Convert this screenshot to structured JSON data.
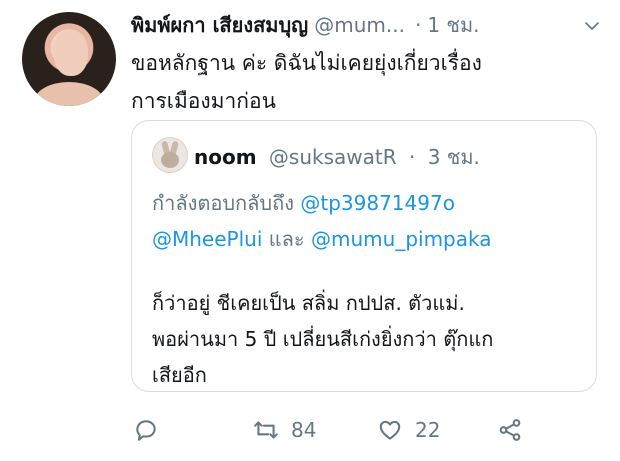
{
  "tweet": {
    "display_name": "พิมพ์ผกา เสียงสมบุญ",
    "handle": "@mum...",
    "dot": "·",
    "time": "1 ชม.",
    "text": "ขอหลักฐาน ค่ะ ดิฉันไม่เคยยุ่งเกี่ยวเรื่อง\nการเมืองมาก่อน"
  },
  "quoted": {
    "name": "noom",
    "handle": "@suksawatR",
    "dot": "·",
    "time": "3 ชม.",
    "reply_prefix": "กำลังตอบกลับถึง ",
    "reply_mention_1": "@tp39871497o",
    "reply_mention_2": "@MheePlui",
    "reply_and": " และ ",
    "reply_mention_3": "@mumu_pimpaka",
    "text": "ก็ว่าอยู่ ชีเคยเป็น สลิ่ม กปปส. ตัวแม่.\nพอผ่านมา 5 ปี เปลี่ยนสีเก่งยิ่งกว่า ตุ๊กแก\nเสียอีก"
  },
  "actions": {
    "retweet_count": "84",
    "like_count": "22"
  },
  "icons": {
    "caret": "chevron-down-icon",
    "reply": "reply-icon",
    "retweet": "retweet-icon",
    "like": "heart-icon",
    "share": "share-icon"
  },
  "colors": {
    "link": "#1b95e0",
    "secondary_text": "#657786",
    "primary_text": "#14171a",
    "border": "#d6dde3"
  }
}
